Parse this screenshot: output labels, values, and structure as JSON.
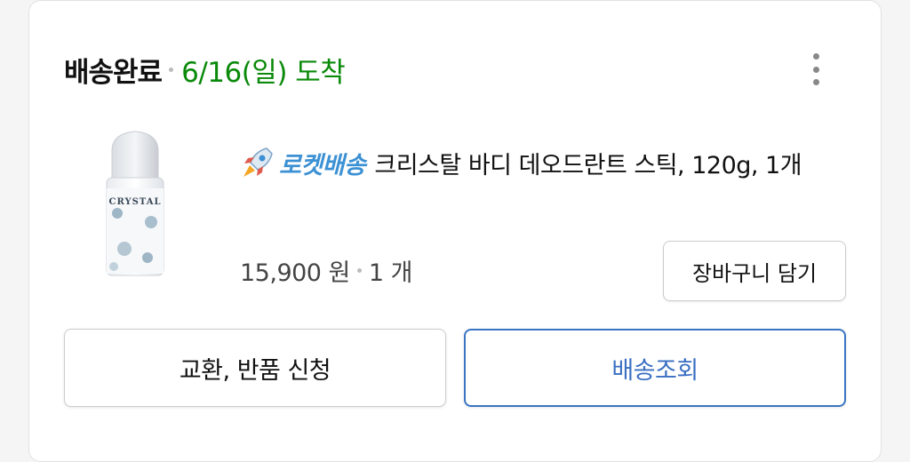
{
  "order": {
    "status": "배송완료",
    "arrival": "6/16(일) 도착"
  },
  "menu": {
    "icon": "more-vertical-icon"
  },
  "product": {
    "image_label": "CRYSTAL",
    "badge_icon": "rocket-icon",
    "badge_label": "로켓배송",
    "name": "크리스탈 바디 데오드란트 스틱, 120g, 1개",
    "price": "15,900 원",
    "quantity": "1 개"
  },
  "buttons": {
    "add_to_cart": "장바구니 담기",
    "return_exchange": "교환, 반품 신청",
    "track_delivery": "배송조회"
  },
  "colors": {
    "arrival_text": "#0a8a0a",
    "rocket_label": "#3c91d4",
    "track_button": "#3a75c4"
  }
}
